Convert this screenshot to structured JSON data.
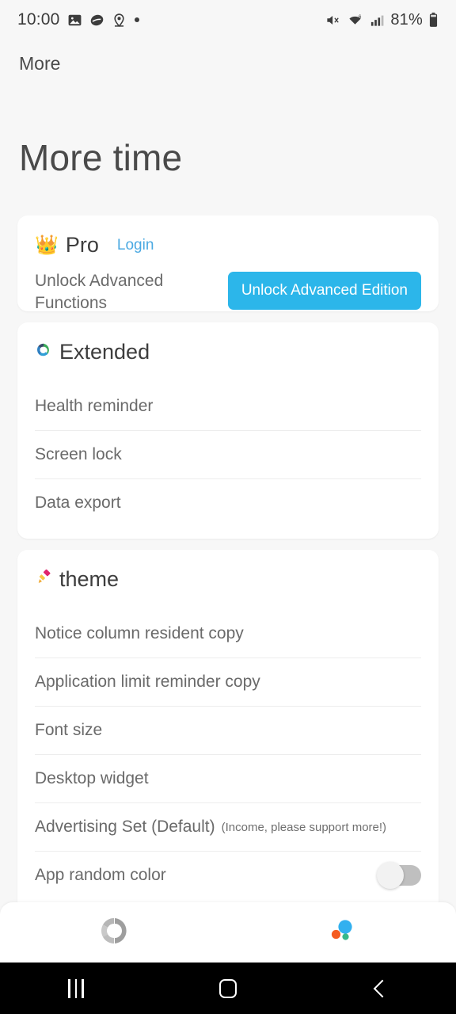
{
  "status_bar": {
    "time": "10:00",
    "battery_percent": "81%",
    "left_icons": [
      "image-icon",
      "eye-oval-icon",
      "location-pin-icon",
      "dot-icon"
    ],
    "right_icons": [
      "mute-icon",
      "wifi-6-icon",
      "signal-bars-icon",
      "battery-icon"
    ]
  },
  "toolbar": {
    "title": "More"
  },
  "header": {
    "title": "More time"
  },
  "colors": {
    "accent_blue": "#2cb6ea",
    "link_blue": "#4ba9e2",
    "page_background": "#f7f7f7",
    "card_background": "#ffffff",
    "text_primary": "#4a4a4a",
    "text_secondary": "#6a6a6a"
  },
  "pro_card": {
    "icon": "crown-emoji",
    "icon_glyph": "👑",
    "title": "Pro",
    "login_label": "Login",
    "description": "Unlock Advanced Functions",
    "button_label": "Unlock Advanced Edition"
  },
  "extended_card": {
    "icon": "recycle-arrows-emoji",
    "icon_glyph": "♻️",
    "title": "Extended",
    "items": [
      {
        "label": "Health reminder"
      },
      {
        "label": "Screen lock"
      },
      {
        "label": "Data export"
      }
    ]
  },
  "theme_card": {
    "icon": "paintbrush-emoji",
    "icon_glyph": "🖌️",
    "title": "theme",
    "items": [
      {
        "label": "Notice column resident copy"
      },
      {
        "label": "Application limit reminder copy"
      },
      {
        "label": "Font size"
      },
      {
        "label": "Desktop widget"
      },
      {
        "label": "Advertising Set (Default)",
        "sub": "(Income, please support more!)"
      },
      {
        "label": "App random color",
        "toggle": "off"
      }
    ]
  },
  "tabbar": {
    "tabs": [
      {
        "name": "statistics-tab",
        "icon": "donut-chart-icon",
        "active": false
      },
      {
        "name": "more-tab",
        "icon": "color-bubbles-icon",
        "active": true
      }
    ]
  },
  "navbar": {
    "buttons": [
      {
        "name": "recents-button",
        "icon": "recents-icon"
      },
      {
        "name": "home-button",
        "icon": "home-icon"
      },
      {
        "name": "back-button",
        "icon": "back-icon"
      }
    ]
  }
}
